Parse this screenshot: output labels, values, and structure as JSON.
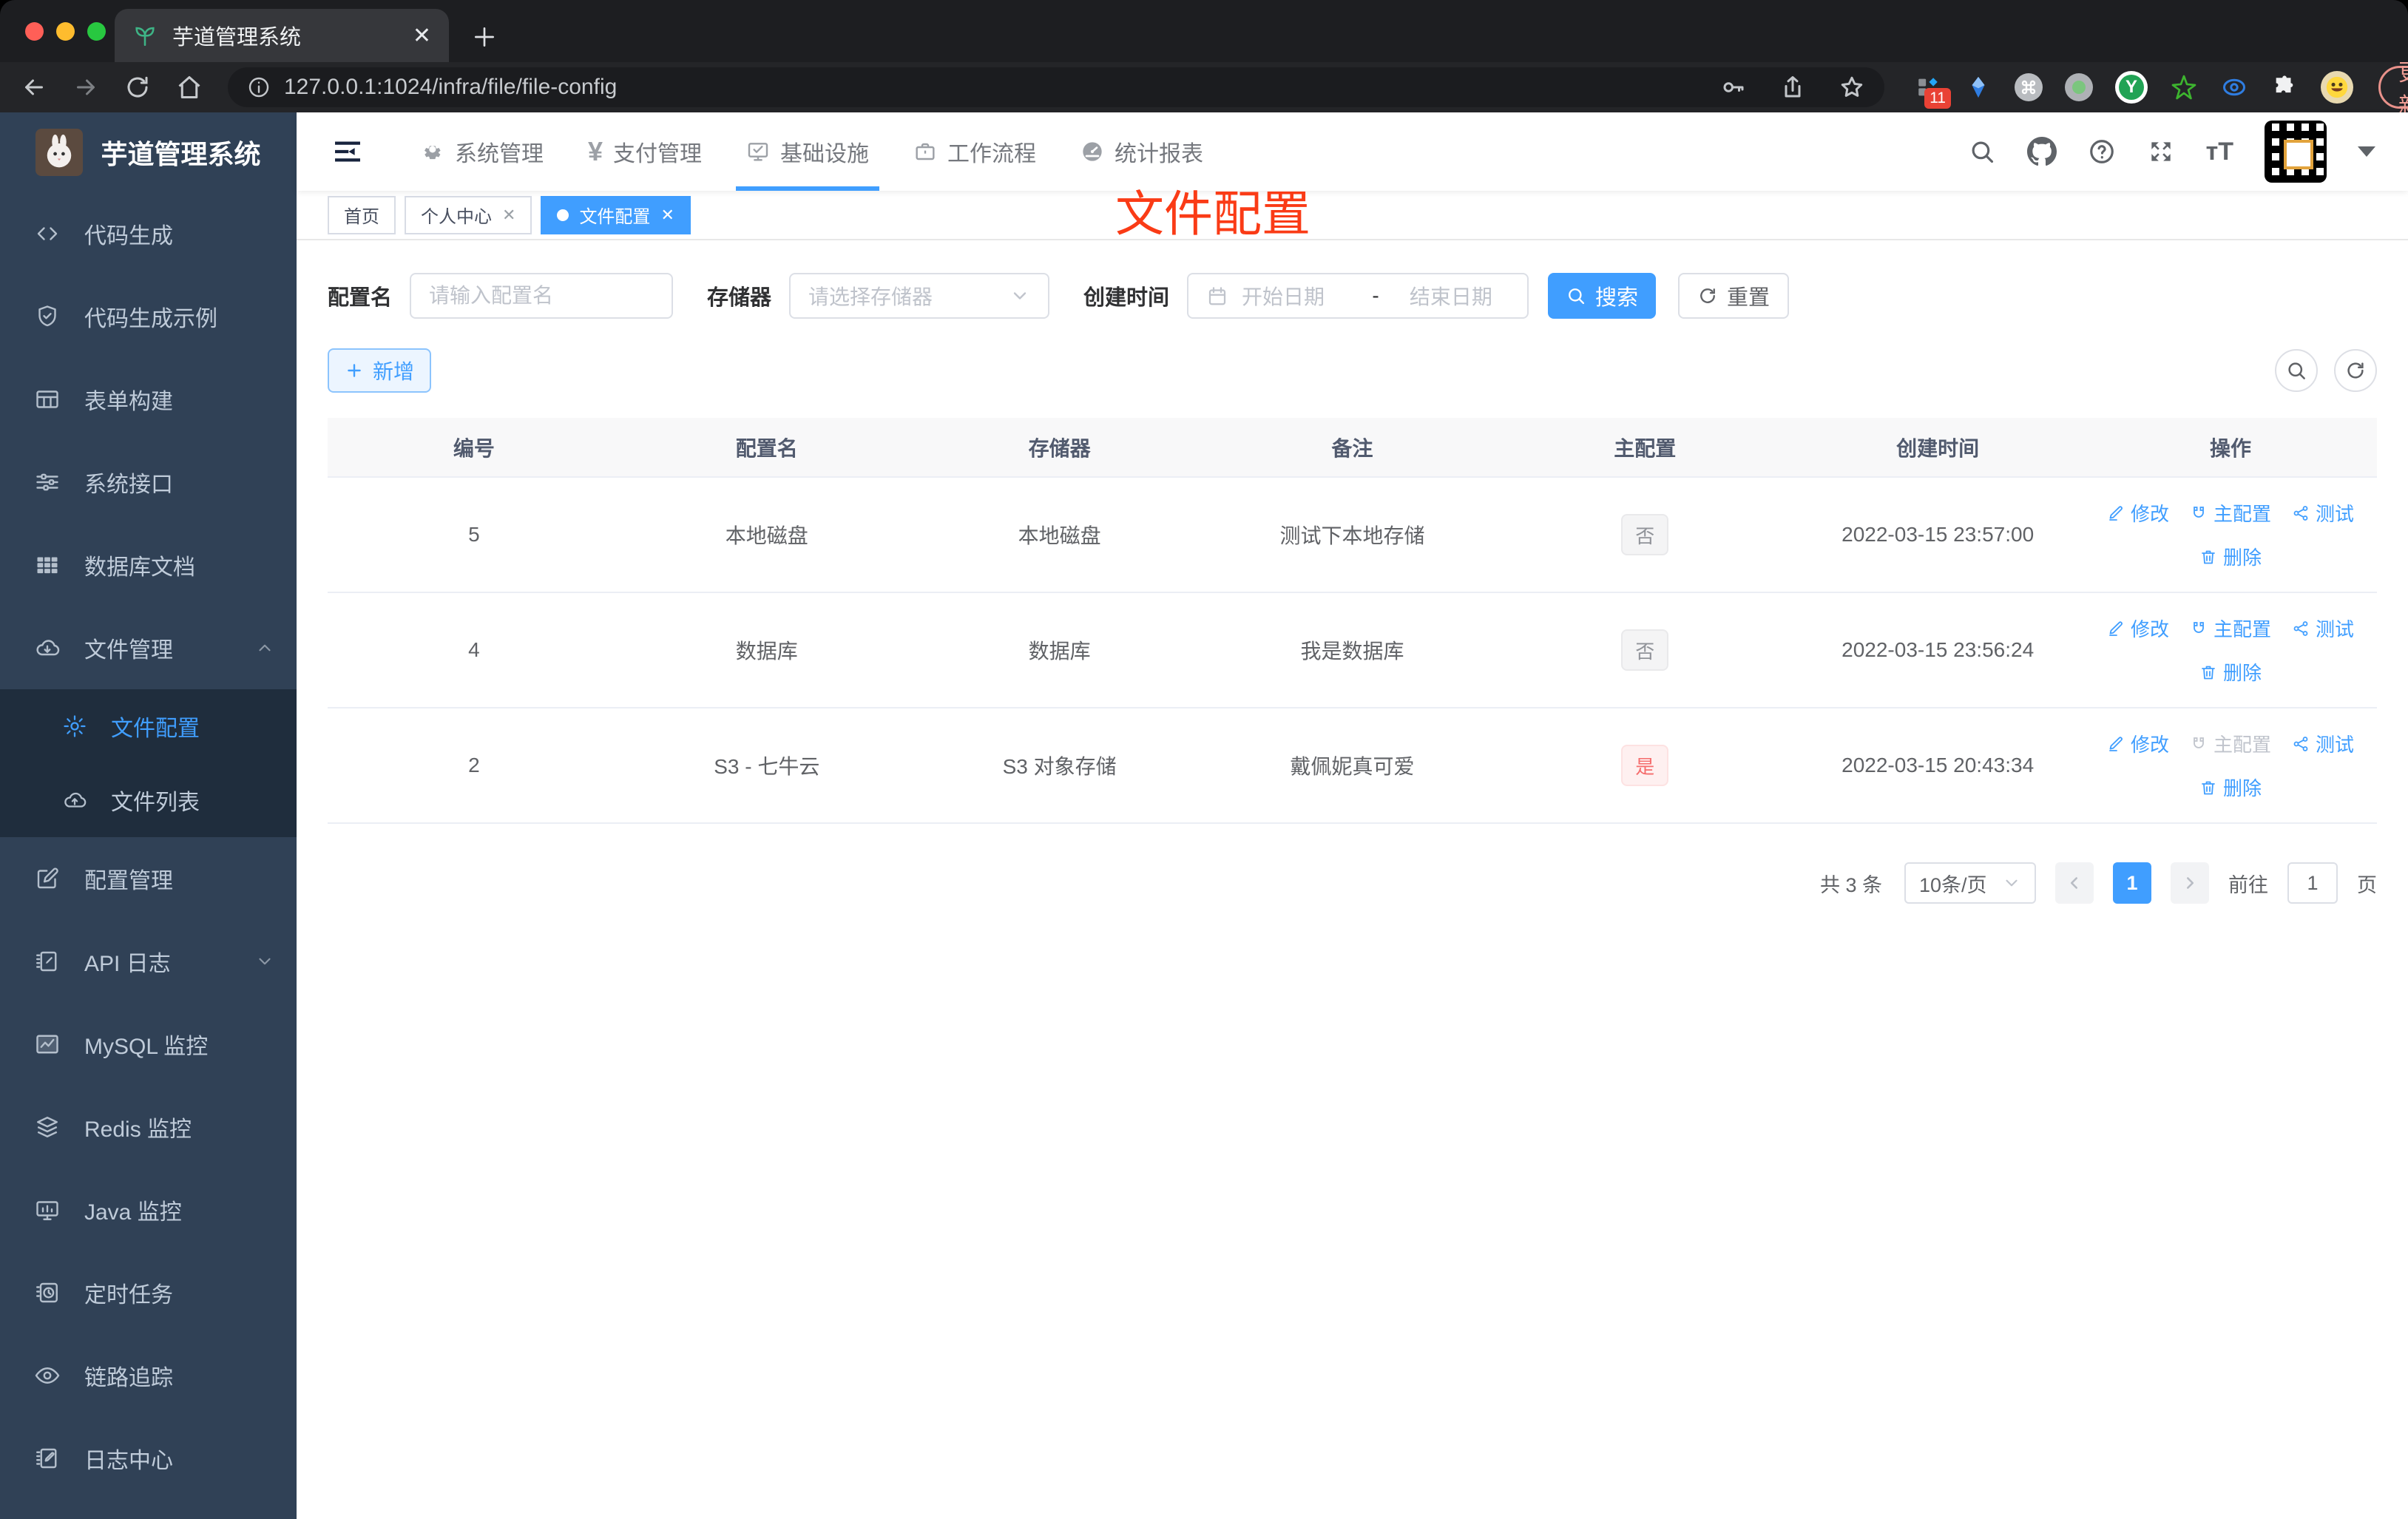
{
  "browser": {
    "tab_title": "芋道管理系统",
    "url": "127.0.0.1:1024/infra/file/file-config",
    "update_label": "更新",
    "extensions_badge": "11",
    "extension_y": "Y"
  },
  "sidebar": {
    "title": "芋道管理系统",
    "items": [
      {
        "label": "代码生成",
        "icon": "code-icon"
      },
      {
        "label": "代码生成示例",
        "icon": "shield-icon"
      },
      {
        "label": "表单构建",
        "icon": "form-icon"
      },
      {
        "label": "系统接口",
        "icon": "sliders-icon"
      },
      {
        "label": "数据库文档",
        "icon": "grid-icon"
      },
      {
        "label": "文件管理",
        "icon": "cloud-download-icon",
        "expanded": true,
        "children": [
          {
            "label": "文件配置",
            "icon": "gear-icon",
            "active": true
          },
          {
            "label": "文件列表",
            "icon": "cloud-upload-icon"
          }
        ]
      },
      {
        "label": "配置管理",
        "icon": "edit-icon"
      },
      {
        "label": "API 日志",
        "icon": "log-icon",
        "collapsed": true
      },
      {
        "label": "MySQL 监控",
        "icon": "chart-icon"
      },
      {
        "label": "Redis 监控",
        "icon": "layers-icon"
      },
      {
        "label": "Java 监控",
        "icon": "monitor-icon"
      },
      {
        "label": "定时任务",
        "icon": "timer-icon"
      },
      {
        "label": "链路追踪",
        "icon": "eye-icon"
      },
      {
        "label": "日志中心",
        "icon": "log-center-icon"
      }
    ]
  },
  "topnav": {
    "items": [
      {
        "label": "系统管理",
        "icon": "gear-icon"
      },
      {
        "label": "支付管理",
        "icon": "yen-icon"
      },
      {
        "label": "基础设施",
        "icon": "infra-icon",
        "active": true
      },
      {
        "label": "工作流程",
        "icon": "briefcase-icon"
      },
      {
        "label": "统计报表",
        "icon": "gauge-icon"
      }
    ]
  },
  "tags": {
    "items": [
      {
        "label": "首页",
        "closable": false,
        "active": false
      },
      {
        "label": "个人中心",
        "closable": true,
        "active": false
      },
      {
        "label": "文件配置",
        "closable": true,
        "active": true
      }
    ]
  },
  "page": {
    "annotation": "文件配置"
  },
  "filters": {
    "config_name_label": "配置名",
    "config_name_placeholder": "请输入配置名",
    "storage_label": "存储器",
    "storage_placeholder": "请选择存储器",
    "created_label": "创建时间",
    "date_start_placeholder": "开始日期",
    "date_separator": "-",
    "date_end_placeholder": "结束日期",
    "search_label": "搜索",
    "reset_label": "重置"
  },
  "toolbar": {
    "add_label": "新增"
  },
  "table": {
    "headers": [
      "编号",
      "配置名",
      "存储器",
      "备注",
      "主配置",
      "创建时间",
      "操作"
    ],
    "actions": {
      "edit": "修改",
      "master": "主配置",
      "test": "测试",
      "delete": "删除"
    },
    "rows": [
      {
        "id": "5",
        "name": "本地磁盘",
        "storage": "本地磁盘",
        "remark": "测试下本地存储",
        "master": "否",
        "master_type": "info",
        "created": "2022-03-15 23:57:00",
        "master_action_disabled": false
      },
      {
        "id": "4",
        "name": "数据库",
        "storage": "数据库",
        "remark": "我是数据库",
        "master": "否",
        "master_type": "info",
        "created": "2022-03-15 23:56:24",
        "master_action_disabled": false
      },
      {
        "id": "2",
        "name": "S3 - 七牛云",
        "storage": "S3 对象存储",
        "remark": "戴佩妮真可爱",
        "master": "是",
        "master_type": "danger",
        "created": "2022-03-15 20:43:34",
        "master_action_disabled": true
      }
    ]
  },
  "pagination": {
    "total": "共 3 条",
    "page_size": "10条/页",
    "current_page": "1",
    "goto_label": "前往",
    "goto_value": "1",
    "page_label": "页"
  },
  "colors": {
    "primary": "#409eff",
    "danger": "#f56c6c",
    "sidebar_bg": "#304156",
    "submenu_bg": "#1f2d3d",
    "annotation_red": "#fa3b16"
  }
}
